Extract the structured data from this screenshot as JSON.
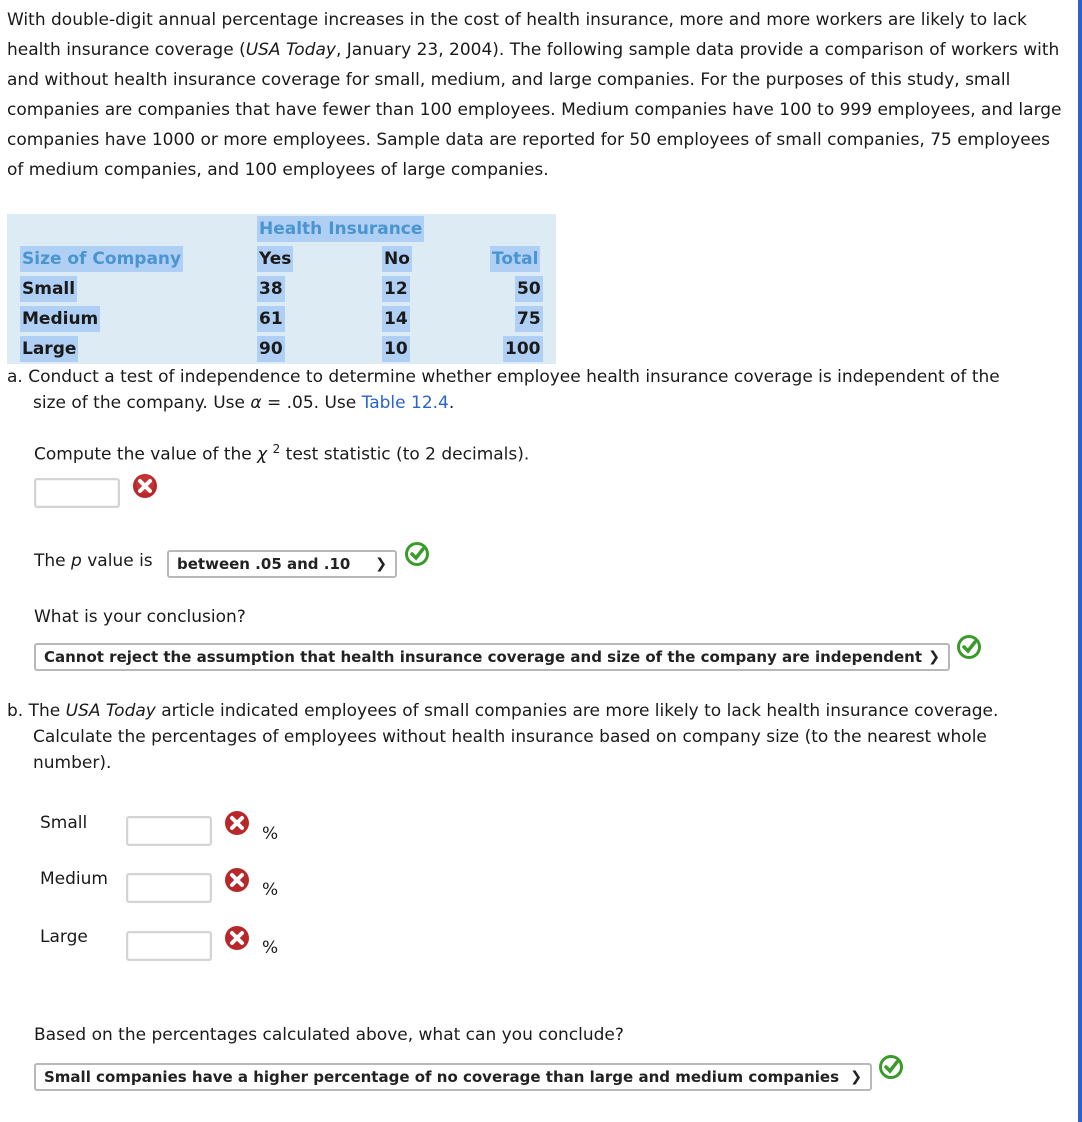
{
  "intro": {
    "part1": "With double-digit annual percentage increases in the cost of health insurance, more and more workers are likely to lack health insurance coverage (",
    "source": "USA Today",
    "part2": ", January 23, 2004). The following sample data provide a comparison of workers with and without health insurance coverage for small, medium, and large companies. For the purposes of this study, small companies are companies that have fewer than 100 employees. Medium companies have 100 to 999 employees, and large companies have 1000 or more employees. Sample data are reported for 50 employees of small companies, 75 employees of medium companies, and 100 employees of large companies."
  },
  "table": {
    "group_header": "Health Insurance",
    "headers": [
      "Size of Company",
      "Yes",
      "No",
      "Total"
    ],
    "rows": [
      {
        "size": "Small",
        "yes": "38",
        "no": "12",
        "total": "50"
      },
      {
        "size": "Medium",
        "yes": "61",
        "no": "14",
        "total": "75"
      },
      {
        "size": "Large",
        "yes": "90",
        "no": "10",
        "total": "100"
      }
    ]
  },
  "part_a": {
    "line1": "a. Conduct a test of independence to determine whether employee health insurance coverage is independent of the",
    "line2_pre": "size of the company. Use ",
    "alpha": "α",
    "line2_mid": " = .05. Use ",
    "table_link": "Table 12.4",
    "line2_post": ".",
    "stat_pre": "Compute the value of the ",
    "chi": "χ",
    "chi_sup": "2",
    "stat_post": " test statistic (to 2 decimals).",
    "stat_value": "",
    "stat_status": "incorrect",
    "p_pre": "The ",
    "p_var": "p",
    "p_post": " value is",
    "p_selected": "between .05 and .10",
    "p_status": "correct",
    "conclusion_label": "What is your conclusion?",
    "conclusion_selected": "Cannot reject the assumption that health insurance coverage and size of the company are independent",
    "conclusion_status": "correct"
  },
  "part_b": {
    "pre": "b. The ",
    "source": "USA Today",
    "post": " article indicated employees of small companies are more likely to lack health insurance coverage.",
    "line2": "Calculate the percentages of employees without health insurance based on company size (to the nearest whole",
    "line3": "number).",
    "rows": [
      {
        "label": "Small",
        "value": "",
        "unit": "%",
        "status": "incorrect"
      },
      {
        "label": "Medium",
        "value": "",
        "unit": "%",
        "status": "incorrect"
      },
      {
        "label": "Large",
        "value": "",
        "unit": "%",
        "status": "incorrect"
      }
    ],
    "based_label": "Based on the percentages calculated above, what can you conclude?",
    "based_selected": "Small companies have a higher percentage of no coverage than large and medium companies",
    "based_status": "correct"
  },
  "icons": {
    "incorrect": "x-circle-icon",
    "correct": "check-circle-icon",
    "dropdown": "chevron-down-icon"
  },
  "colors": {
    "accent": "#2a64c8",
    "table_bg": "#dcebf4",
    "highlight": "#afd0f4",
    "header_text": "#4a94d0",
    "error": "#c0282a",
    "success": "#3a9a2a"
  }
}
